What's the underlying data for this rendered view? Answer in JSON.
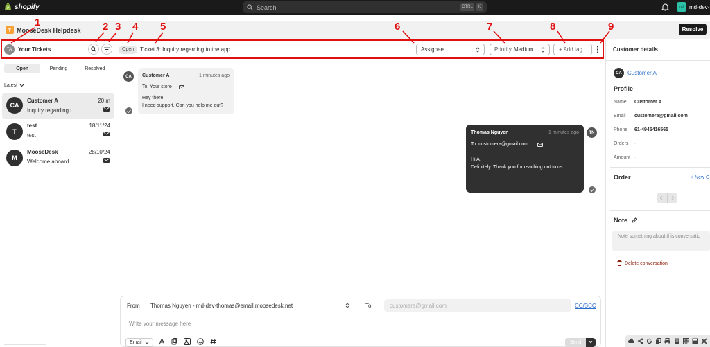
{
  "shopify": {
    "brand": "shopify",
    "search_placeholder": "Search",
    "kbd1": "CTRL",
    "kbd2": "K",
    "store_initials": "md-",
    "store_name": "md-dev-t"
  },
  "app": {
    "name": "MooseDesk Helpdesk",
    "resolve_label": "Resolve"
  },
  "header": {
    "user_initials": "TA",
    "your_tickets": "Your Tickets",
    "status_badge": "Open",
    "ticket_title": "Ticket 3: Inquiry regarding to the app",
    "assignee_label": "Assignee",
    "priority_label": "Priority",
    "priority_value": "Medium",
    "add_tag_label": "+ Add tag"
  },
  "annotations": [
    "1",
    "2",
    "3",
    "4",
    "5",
    "6",
    "7",
    "8",
    "9"
  ],
  "sidebar": {
    "tabs": [
      "Open",
      "Pending",
      "Resolved"
    ],
    "sort_label": "Latest",
    "conversations": [
      {
        "initials": "CA",
        "name": "Customer A",
        "time": "20 m",
        "preview": "Inquiry regarding t..."
      },
      {
        "initials": "T",
        "name": "test",
        "time": "18/11/24",
        "preview": "test"
      },
      {
        "initials": "M",
        "name": "MooseDesk",
        "time": "28/10/24",
        "preview": "Welcome aboard ..."
      }
    ]
  },
  "thread": {
    "incoming": {
      "initials": "CA",
      "name": "Customer A",
      "time": "1 minutes ago",
      "to": "To: Your store",
      "lines": [
        "Hey there,",
        "I need support. Can you help me out?"
      ]
    },
    "outgoing": {
      "initials": "TN",
      "name": "Thomas Nguyen",
      "time": "1 minutes ago",
      "to": "To: customera@gmail.com",
      "lines": [
        "Hi A,",
        "Definitely. Thank you for reaching out to us."
      ]
    }
  },
  "composer": {
    "from_label": "From",
    "from_value": "Thomas Nguyen - md-dev-thomas@email.moosedesk.net",
    "to_label": "To",
    "to_value": "customera@gmail.com",
    "ccbcc": "CC/BCC",
    "placeholder": "Write your message here",
    "channel": "Email",
    "send": "Send"
  },
  "customer": {
    "panel_title": "Customer details",
    "initials": "CA",
    "name_link": "Customer A",
    "profile_heading": "Profile",
    "fields": [
      {
        "label": "Name",
        "value": "Customer A"
      },
      {
        "label": "Email",
        "value": "customera@gmail.com"
      },
      {
        "label": "Phone",
        "value": "61-4945416565"
      },
      {
        "label": "Orders",
        "value": "-"
      },
      {
        "label": "Amount",
        "value": "-"
      }
    ],
    "order_heading": "Order",
    "new_order": "+ New O",
    "note_heading": "Note",
    "note_placeholder": "Note something about this conversatio",
    "delete_label": "Delete conversation"
  }
}
